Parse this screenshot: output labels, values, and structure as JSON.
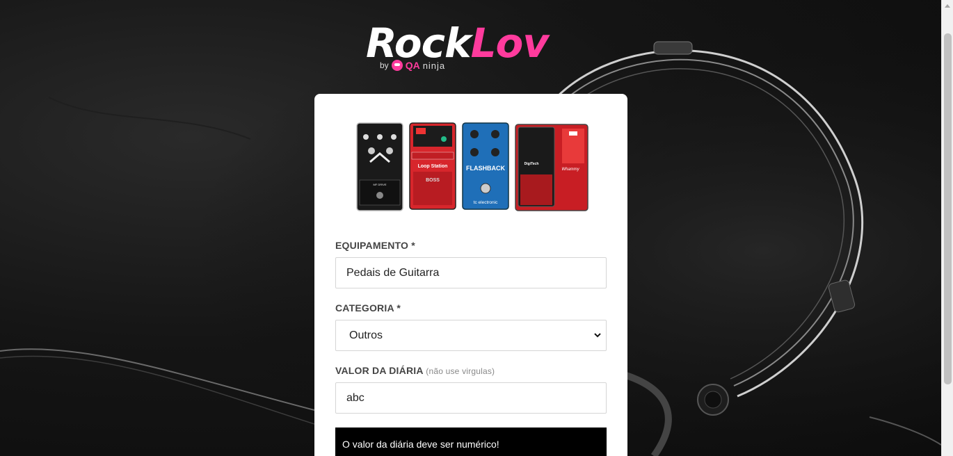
{
  "brand": {
    "name_part1": "Rock",
    "name_part2": "Lov",
    "by": "by",
    "qa": "QA",
    "ninja": "ninja",
    "accent_color": "#ff3b9d"
  },
  "form": {
    "equipment": {
      "label": "EQUIPAMENTO *",
      "value": "Pedais de Guitarra"
    },
    "category": {
      "label": "CATEGORIA *",
      "selected": "Outros"
    },
    "daily_price": {
      "label": "VALOR DA DIÁRIA",
      "hint": "(não use virgulas)",
      "value": "abc"
    },
    "error_alert": "O valor da diária deve ser numérico!"
  },
  "pedal_labels": {
    "p1": "MF DRIVE",
    "p2": "Loop Station",
    "p2b": "BOSS",
    "p3": "FLASHBACK",
    "p3b": "tc electronic",
    "p4": "DigiTech",
    "p4b": "Whammy"
  }
}
